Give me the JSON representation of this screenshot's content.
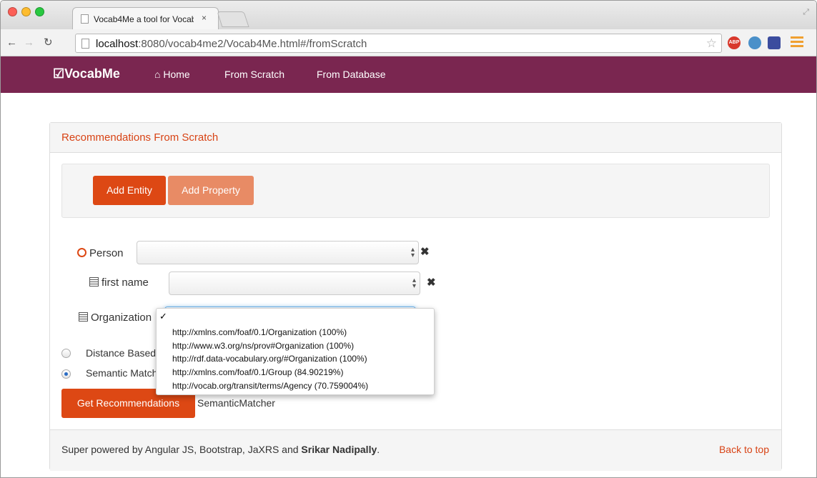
{
  "browser": {
    "tab_title": "Vocab4Me a tool for Vocab",
    "tab_close": "×",
    "url_host": "localhost",
    "url_rest": ":8080/vocab4me2/Vocab4Me.html#/fromScratch",
    "extensions": {
      "abp": "ABP"
    }
  },
  "navbar": {
    "brand": "VocabMe",
    "links": {
      "home": "Home",
      "from_scratch": "From Scratch",
      "from_database": "From Database"
    },
    "color": "#7a2650"
  },
  "panel": {
    "title": "Recommendations From Scratch",
    "add_entity": "Add Entity",
    "add_property": "Add Property",
    "entity_label": "Person",
    "property_label": "first name",
    "organization_label": "Organization",
    "remove_symbol": "✖",
    "radio": {
      "distance": "Distance Based",
      "semantic": "Semantic Matcher"
    },
    "get_recommendations": "Get Recommendations",
    "selected_matcher": "SemanticMatcher"
  },
  "dropdown": {
    "check": "✓",
    "options": [
      "http://xmlns.com/foaf/0.1/Organization (100%)",
      "http://www.w3.org/ns/prov#Organization (100%)",
      "http://rdf.data-vocabulary.org/#Organization (100%)",
      "http://xmlns.com/foaf/0.1/Group (84.90219%)",
      "http://vocab.org/transit/terms/Agency (70.759004%)"
    ]
  },
  "footer": {
    "text": "Super powered by Angular JS, Bootstrap, JaXRS and ",
    "author": "Srikar Nadipally",
    "period": ".",
    "back_to_top": "Back to top"
  },
  "colors": {
    "accent": "#dd4814",
    "accent_light": "#e88b65",
    "title": "#d84315"
  }
}
